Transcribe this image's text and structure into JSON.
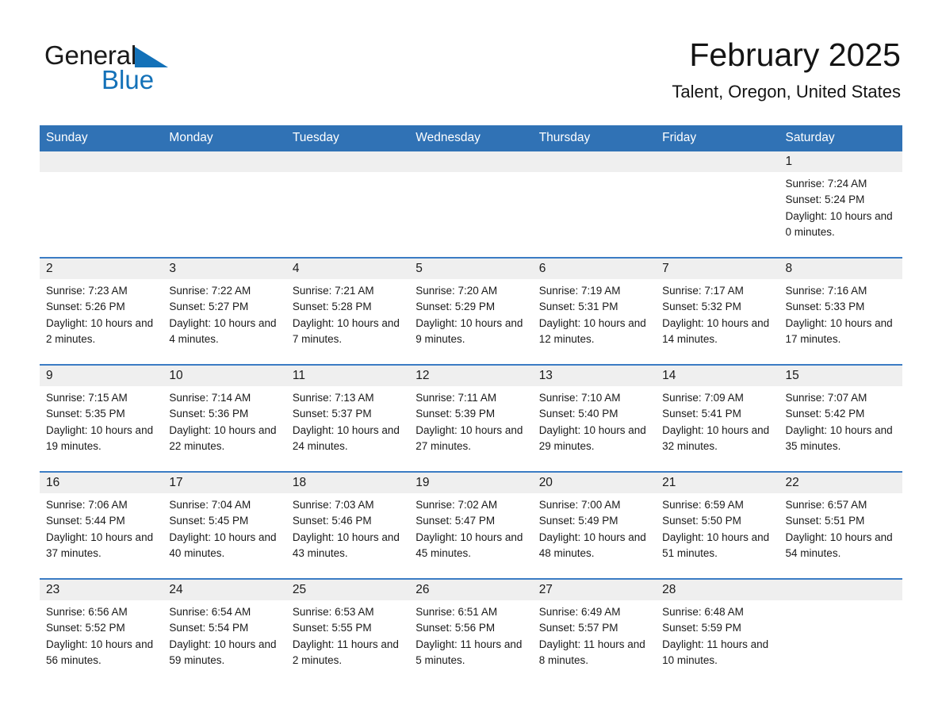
{
  "brand": {
    "name_part1": "General",
    "name_part2": "Blue",
    "accent_color": "#1371b8",
    "logo_icon": "triangle-flag-icon"
  },
  "header": {
    "title": "February 2025",
    "location": "Talent, Oregon, United States",
    "header_bg_color": "#3072b5",
    "row_divider_color": "#3b7cc4",
    "daynum_bg_color": "#efefef"
  },
  "calendar": {
    "month": "February",
    "year": "2025",
    "weekday_headers": [
      "Sunday",
      "Monday",
      "Tuesday",
      "Wednesday",
      "Thursday",
      "Friday",
      "Saturday"
    ],
    "weeks": [
      [
        {
          "day": "",
          "sunrise": "",
          "sunset": "",
          "daylight": ""
        },
        {
          "day": "",
          "sunrise": "",
          "sunset": "",
          "daylight": ""
        },
        {
          "day": "",
          "sunrise": "",
          "sunset": "",
          "daylight": ""
        },
        {
          "day": "",
          "sunrise": "",
          "sunset": "",
          "daylight": ""
        },
        {
          "day": "",
          "sunrise": "",
          "sunset": "",
          "daylight": ""
        },
        {
          "day": "",
          "sunrise": "",
          "sunset": "",
          "daylight": ""
        },
        {
          "day": "1",
          "sunrise": "Sunrise: 7:24 AM",
          "sunset": "Sunset: 5:24 PM",
          "daylight": "Daylight: 10 hours and 0 minutes."
        }
      ],
      [
        {
          "day": "2",
          "sunrise": "Sunrise: 7:23 AM",
          "sunset": "Sunset: 5:26 PM",
          "daylight": "Daylight: 10 hours and 2 minutes."
        },
        {
          "day": "3",
          "sunrise": "Sunrise: 7:22 AM",
          "sunset": "Sunset: 5:27 PM",
          "daylight": "Daylight: 10 hours and 4 minutes."
        },
        {
          "day": "4",
          "sunrise": "Sunrise: 7:21 AM",
          "sunset": "Sunset: 5:28 PM",
          "daylight": "Daylight: 10 hours and 7 minutes."
        },
        {
          "day": "5",
          "sunrise": "Sunrise: 7:20 AM",
          "sunset": "Sunset: 5:29 PM",
          "daylight": "Daylight: 10 hours and 9 minutes."
        },
        {
          "day": "6",
          "sunrise": "Sunrise: 7:19 AM",
          "sunset": "Sunset: 5:31 PM",
          "daylight": "Daylight: 10 hours and 12 minutes."
        },
        {
          "day": "7",
          "sunrise": "Sunrise: 7:17 AM",
          "sunset": "Sunset: 5:32 PM",
          "daylight": "Daylight: 10 hours and 14 minutes."
        },
        {
          "day": "8",
          "sunrise": "Sunrise: 7:16 AM",
          "sunset": "Sunset: 5:33 PM",
          "daylight": "Daylight: 10 hours and 17 minutes."
        }
      ],
      [
        {
          "day": "9",
          "sunrise": "Sunrise: 7:15 AM",
          "sunset": "Sunset: 5:35 PM",
          "daylight": "Daylight: 10 hours and 19 minutes."
        },
        {
          "day": "10",
          "sunrise": "Sunrise: 7:14 AM",
          "sunset": "Sunset: 5:36 PM",
          "daylight": "Daylight: 10 hours and 22 minutes."
        },
        {
          "day": "11",
          "sunrise": "Sunrise: 7:13 AM",
          "sunset": "Sunset: 5:37 PM",
          "daylight": "Daylight: 10 hours and 24 minutes."
        },
        {
          "day": "12",
          "sunrise": "Sunrise: 7:11 AM",
          "sunset": "Sunset: 5:39 PM",
          "daylight": "Daylight: 10 hours and 27 minutes."
        },
        {
          "day": "13",
          "sunrise": "Sunrise: 7:10 AM",
          "sunset": "Sunset: 5:40 PM",
          "daylight": "Daylight: 10 hours and 29 minutes."
        },
        {
          "day": "14",
          "sunrise": "Sunrise: 7:09 AM",
          "sunset": "Sunset: 5:41 PM",
          "daylight": "Daylight: 10 hours and 32 minutes."
        },
        {
          "day": "15",
          "sunrise": "Sunrise: 7:07 AM",
          "sunset": "Sunset: 5:42 PM",
          "daylight": "Daylight: 10 hours and 35 minutes."
        }
      ],
      [
        {
          "day": "16",
          "sunrise": "Sunrise: 7:06 AM",
          "sunset": "Sunset: 5:44 PM",
          "daylight": "Daylight: 10 hours and 37 minutes."
        },
        {
          "day": "17",
          "sunrise": "Sunrise: 7:04 AM",
          "sunset": "Sunset: 5:45 PM",
          "daylight": "Daylight: 10 hours and 40 minutes."
        },
        {
          "day": "18",
          "sunrise": "Sunrise: 7:03 AM",
          "sunset": "Sunset: 5:46 PM",
          "daylight": "Daylight: 10 hours and 43 minutes."
        },
        {
          "day": "19",
          "sunrise": "Sunrise: 7:02 AM",
          "sunset": "Sunset: 5:47 PM",
          "daylight": "Daylight: 10 hours and 45 minutes."
        },
        {
          "day": "20",
          "sunrise": "Sunrise: 7:00 AM",
          "sunset": "Sunset: 5:49 PM",
          "daylight": "Daylight: 10 hours and 48 minutes."
        },
        {
          "day": "21",
          "sunrise": "Sunrise: 6:59 AM",
          "sunset": "Sunset: 5:50 PM",
          "daylight": "Daylight: 10 hours and 51 minutes."
        },
        {
          "day": "22",
          "sunrise": "Sunrise: 6:57 AM",
          "sunset": "Sunset: 5:51 PM",
          "daylight": "Daylight: 10 hours and 54 minutes."
        }
      ],
      [
        {
          "day": "23",
          "sunrise": "Sunrise: 6:56 AM",
          "sunset": "Sunset: 5:52 PM",
          "daylight": "Daylight: 10 hours and 56 minutes."
        },
        {
          "day": "24",
          "sunrise": "Sunrise: 6:54 AM",
          "sunset": "Sunset: 5:54 PM",
          "daylight": "Daylight: 10 hours and 59 minutes."
        },
        {
          "day": "25",
          "sunrise": "Sunrise: 6:53 AM",
          "sunset": "Sunset: 5:55 PM",
          "daylight": "Daylight: 11 hours and 2 minutes."
        },
        {
          "day": "26",
          "sunrise": "Sunrise: 6:51 AM",
          "sunset": "Sunset: 5:56 PM",
          "daylight": "Daylight: 11 hours and 5 minutes."
        },
        {
          "day": "27",
          "sunrise": "Sunrise: 6:49 AM",
          "sunset": "Sunset: 5:57 PM",
          "daylight": "Daylight: 11 hours and 8 minutes."
        },
        {
          "day": "28",
          "sunrise": "Sunrise: 6:48 AM",
          "sunset": "Sunset: 5:59 PM",
          "daylight": "Daylight: 11 hours and 10 minutes."
        },
        {
          "day": "",
          "sunrise": "",
          "sunset": "",
          "daylight": ""
        }
      ]
    ]
  }
}
